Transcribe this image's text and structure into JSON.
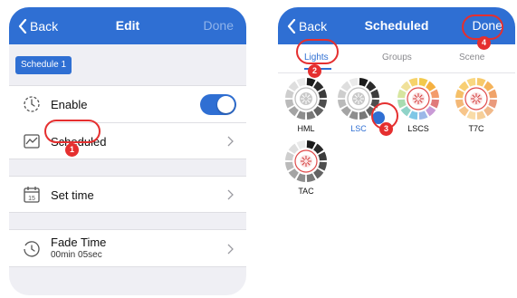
{
  "edit_screen": {
    "nav": {
      "back_label": "Back",
      "title": "Edit",
      "done_label": "Done"
    },
    "schedule_badge": "Schedule 1",
    "rows": {
      "enable": {
        "label": "Enable",
        "on": true
      },
      "scheduled": {
        "label": "Scheduled"
      },
      "set_time": {
        "label": "Set time",
        "calendar_day": "15"
      },
      "fade_time": {
        "label": "Fade Time",
        "value": "00min 05sec"
      }
    }
  },
  "scheduled_screen": {
    "nav": {
      "back_label": "Back",
      "title": "Scheduled",
      "done_label": "Done"
    },
    "tabs": [
      {
        "label": "Lights",
        "active": true
      },
      {
        "label": "Groups",
        "active": false
      },
      {
        "label": "Scene",
        "active": false
      }
    ],
    "devices": [
      {
        "label": "HML",
        "selected": false,
        "style": "gray"
      },
      {
        "label": "LSC",
        "selected": true,
        "style": "gray"
      },
      {
        "label": "LSCS",
        "selected": false,
        "style": "color"
      },
      {
        "label": "T7C",
        "selected": false,
        "style": "color-warm"
      },
      {
        "label": "TAC",
        "selected": false,
        "style": "gray-red"
      }
    ]
  },
  "annotations": [
    "1",
    "2",
    "3",
    "4"
  ],
  "colors": {
    "primary": "#2f6fd3",
    "annotation": "#e52f2f",
    "background": "#efeff4"
  }
}
